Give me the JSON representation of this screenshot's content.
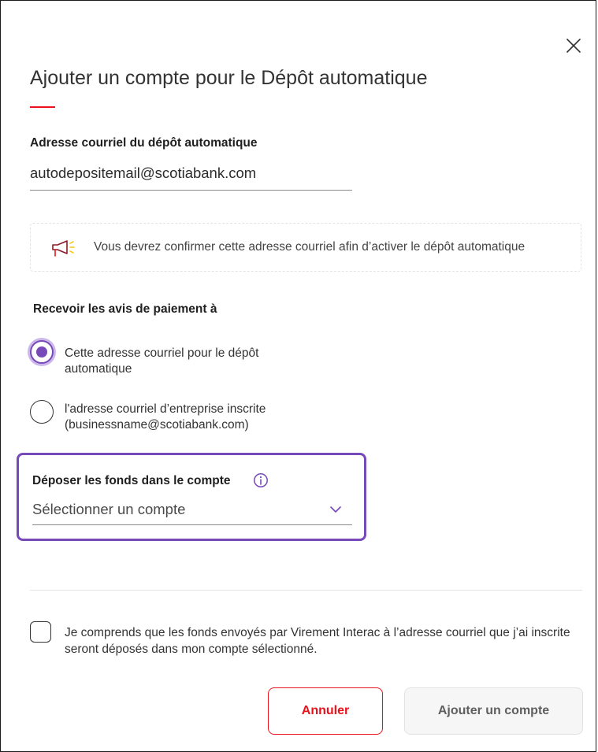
{
  "dialog": {
    "title": "Ajouter un compte pour le Dépôt automatique",
    "close_icon": "close-icon"
  },
  "email_field": {
    "label": "Adresse courriel du dépôt automatique",
    "value": "autodepositemail@scotiabank.com"
  },
  "notice": {
    "icon": "megaphone-icon",
    "text": "Vous devrez confirmer cette adresse courriel afin d’activer le dépôt automatique"
  },
  "notifications": {
    "label": "Recevoir les avis de paiement à",
    "options": [
      {
        "label": "Cette adresse courriel pour le dépôt automatique",
        "selected": true
      },
      {
        "label": "l'adresse courriel d’entreprise inscrite (businessname@scotiabank.com)",
        "selected": false
      }
    ]
  },
  "deposit_account": {
    "label": "Déposer les fonds dans le compte",
    "info_icon": "info-icon",
    "placeholder": "Sélectionner un compte"
  },
  "consent": {
    "text": "Je comprends que les fonds envoyés par Virement Interac à l’adresse courriel que j’ai inscrite seront déposés dans mon compte sélectionné.",
    "checked": false
  },
  "buttons": {
    "cancel": "Annuler",
    "add_account": "Ajouter un compte"
  },
  "colors": {
    "accent_red": "#ec111a",
    "focus_purple": "#7849b8",
    "megaphone_yellow": "#f5c400"
  }
}
